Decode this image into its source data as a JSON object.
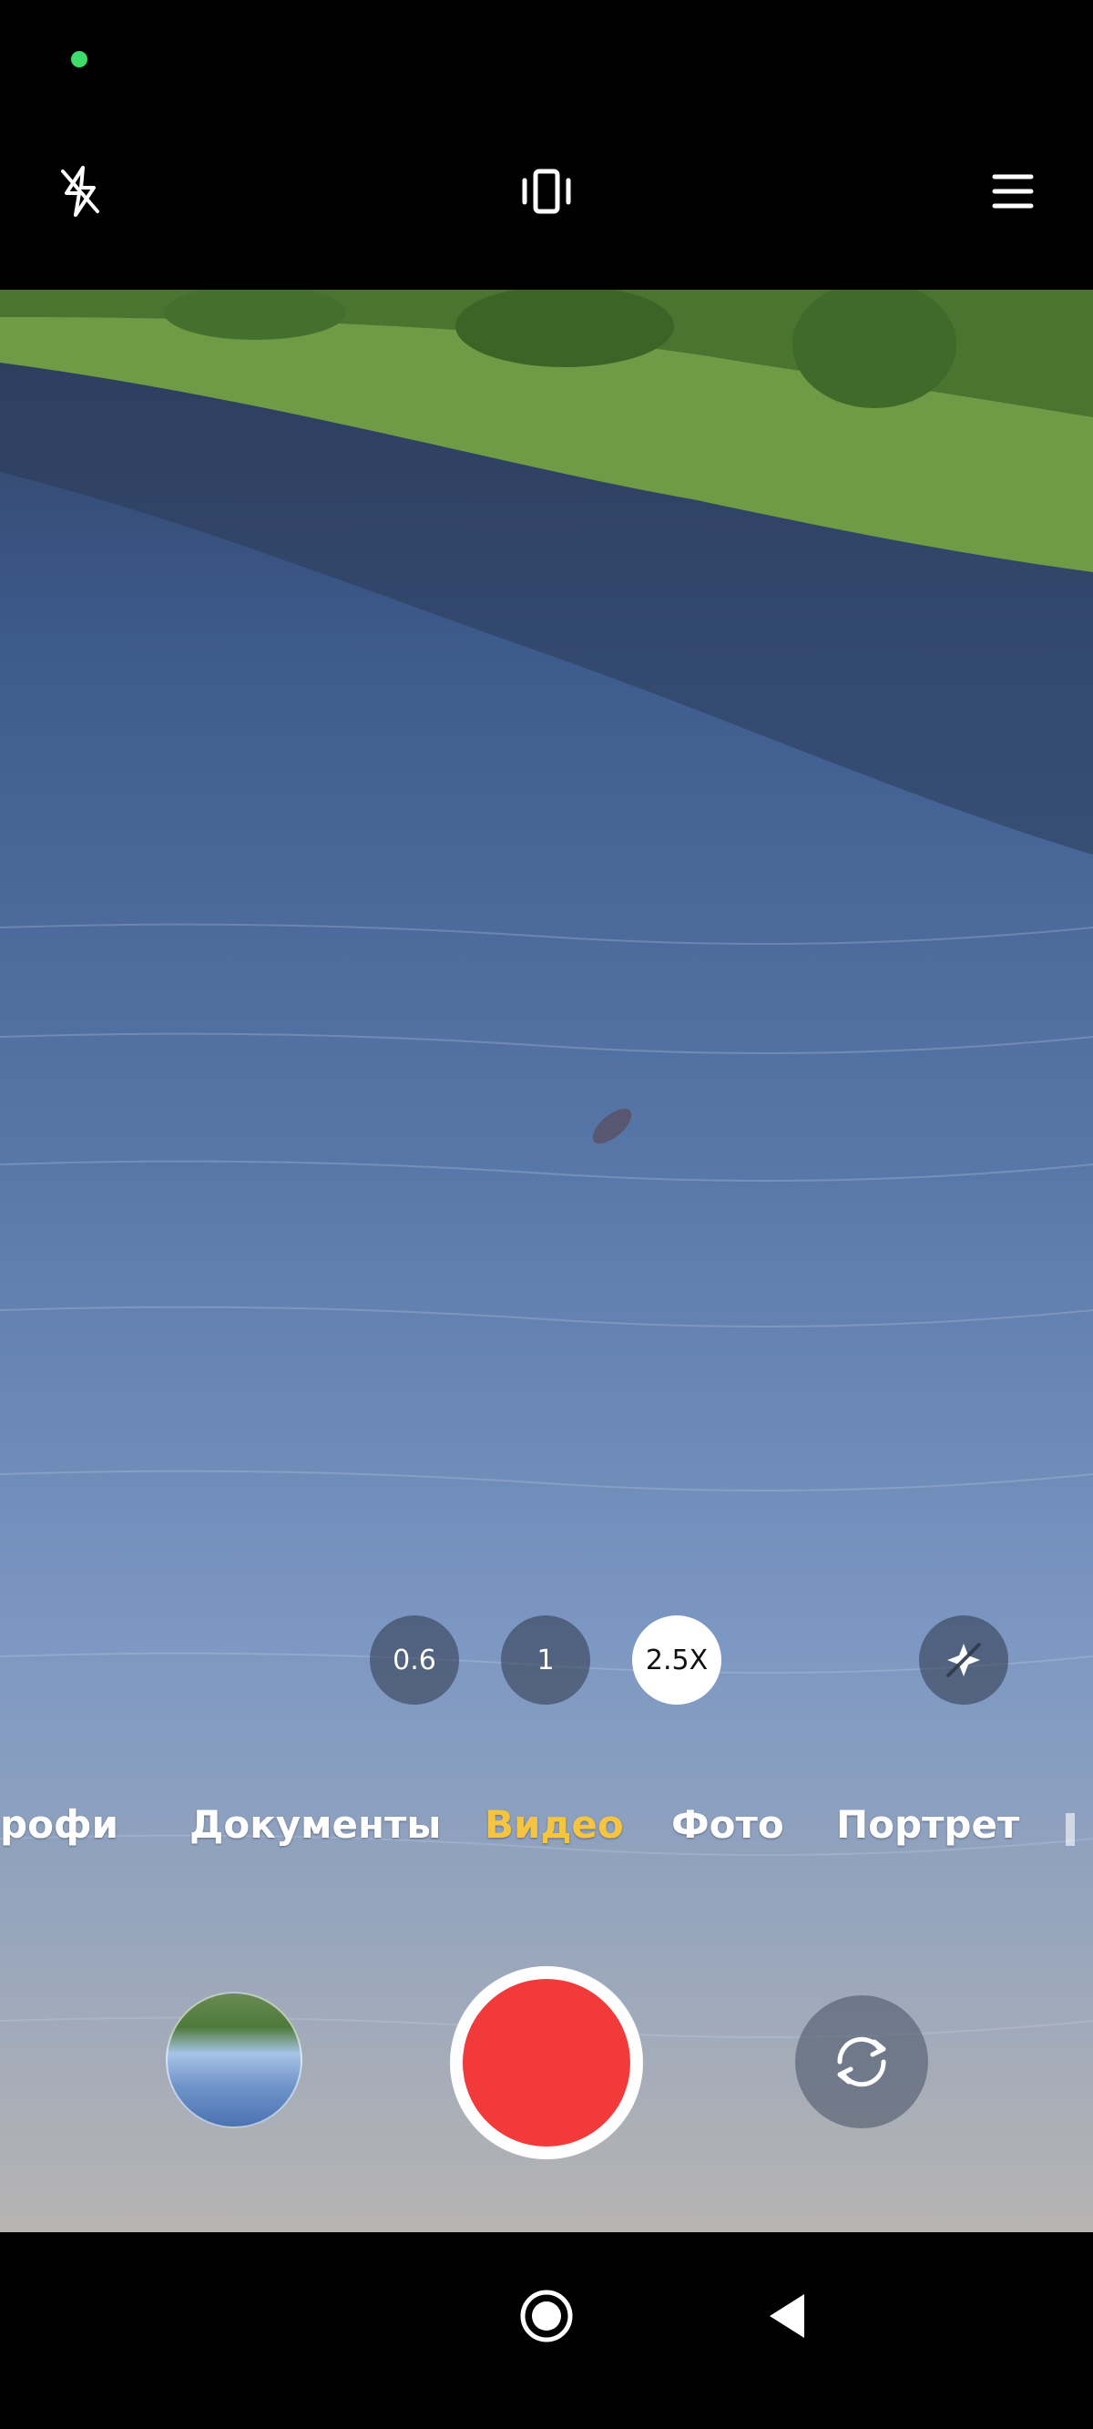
{
  "status_bar": {
    "indicator_color": "#3ddc6b"
  },
  "top_bar": {
    "flash_icon": "flash-off-icon",
    "stabilization_icon": "stabilization-icon",
    "menu_icon": "menu-icon"
  },
  "zoom": {
    "levels": [
      "0.6",
      "1",
      "2.5X"
    ],
    "selected_index": 2
  },
  "effect_icon": "sparkle-effect-icon",
  "modes": {
    "items": [
      "рофи",
      "Документы",
      "Видео",
      "Фото",
      "Портрет"
    ],
    "active": "Видео",
    "active_color": "#f5c542"
  },
  "controls": {
    "gallery_icon": "gallery-thumbnail",
    "record_color": "#f23a3a",
    "switch_icon": "switch-camera-icon"
  },
  "nav": {
    "home_icon": "home-circle-icon",
    "back_icon": "back-triangle-icon"
  }
}
